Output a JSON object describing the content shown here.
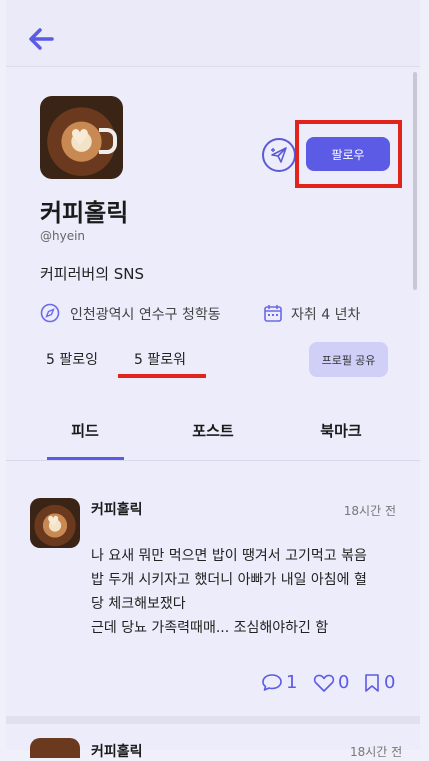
{
  "profile": {
    "name": "커피홀릭",
    "handle": "@hyein",
    "bio": "커피러버의 SNS",
    "location": "인천광역시 연수구 청학동",
    "experience": "자취 4 년차",
    "following": "5 팔로잉",
    "followers": "5 팔로워",
    "follow_label": "팔로우",
    "share_label": "프로필 공유"
  },
  "tabs": [
    {
      "label": "피드"
    },
    {
      "label": "포스트"
    },
    {
      "label": "북마크"
    }
  ],
  "post": {
    "author": "커피홀릭",
    "time": "18시간 전",
    "lines": [
      "나 요새 뭐만 먹으면 밥이 땡겨서 고기먹고 볶음",
      "밥 두개 시키자고 했더니 아빠가 내일 아침에 혈",
      "당 체크해보쟀다",
      "근데 당뇨 가족력때매... 조심해야하긴 함"
    ],
    "comments": "1",
    "likes": "0",
    "bookmarks": "0"
  },
  "next_post": {
    "author": "커피홀릭",
    "time": "18시간 전"
  },
  "colors": {
    "accent": "#5b5be6",
    "highlight": "#e0241c"
  }
}
